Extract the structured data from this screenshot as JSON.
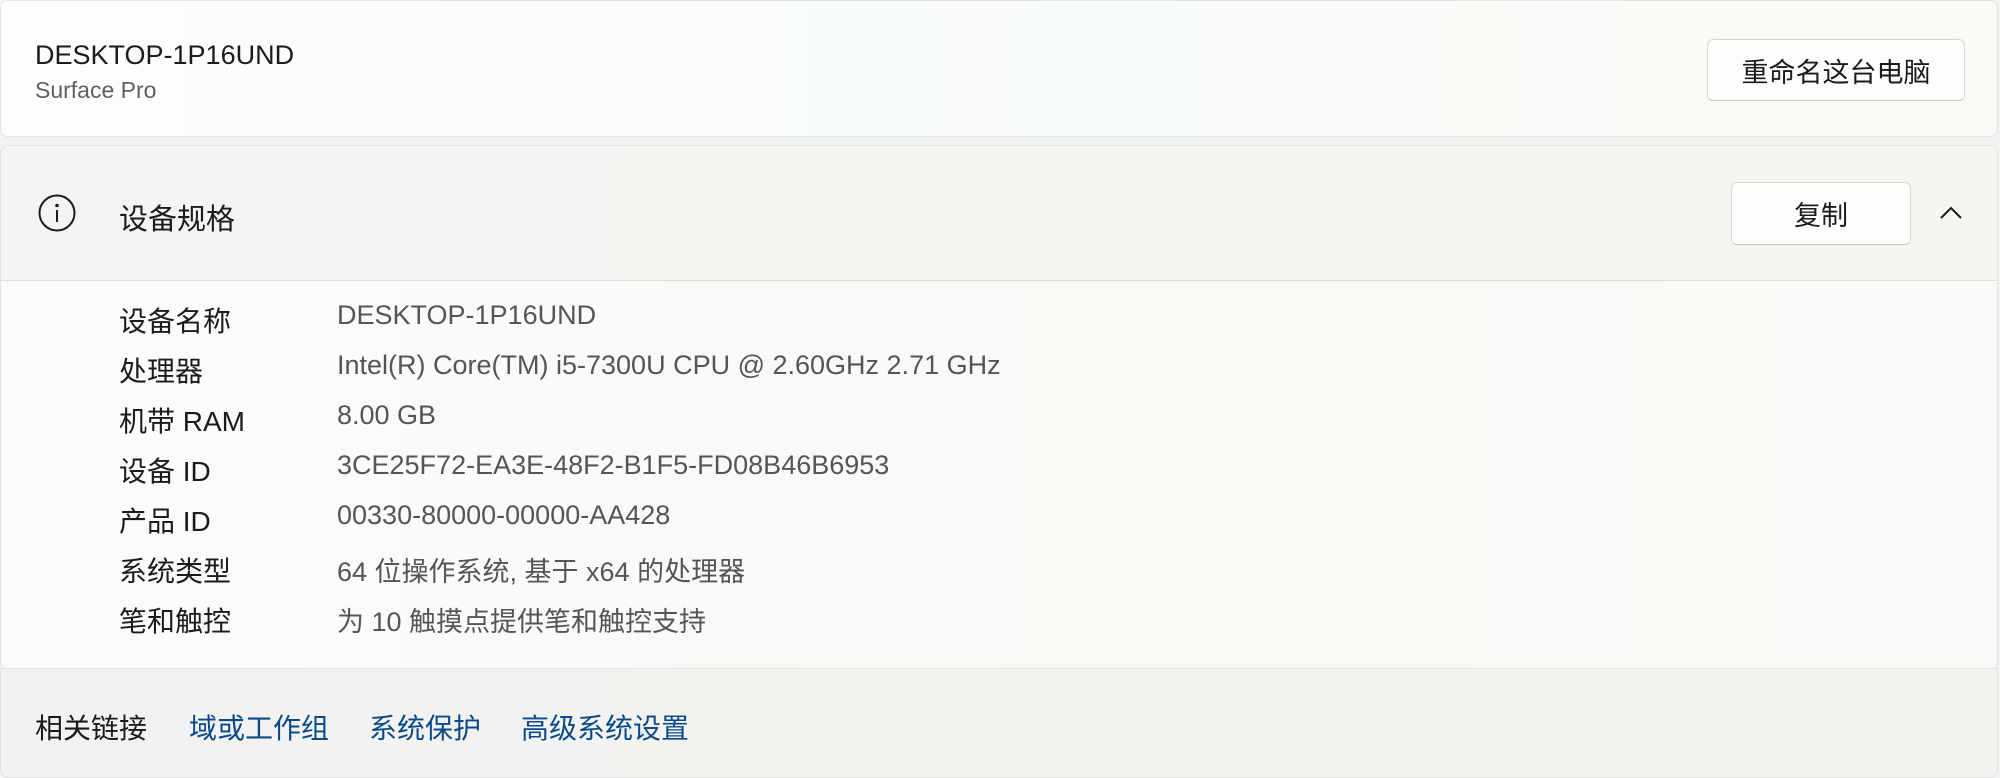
{
  "device": {
    "name": "DESKTOP-1P16UND",
    "model": "Surface Pro",
    "rename_label": "重命名这台电脑"
  },
  "specs": {
    "title": "设备规格",
    "icon": "info-icon",
    "copy_label": "复制",
    "collapse_icon": "chevron-up-icon",
    "rows": [
      {
        "label": "设备名称",
        "value": "DESKTOP-1P16UND"
      },
      {
        "label": "处理器",
        "value": "Intel(R) Core(TM) i5-7300U CPU @ 2.60GHz   2.71 GHz"
      },
      {
        "label": "机带 RAM",
        "value": "8.00 GB"
      },
      {
        "label": "设备 ID",
        "value": "3CE25F72-EA3E-48F2-B1F5-FD08B46B6953"
      },
      {
        "label": "产品 ID",
        "value": "00330-80000-00000-AA428"
      },
      {
        "label": "系统类型",
        "value": "64 位操作系统, 基于 x64 的处理器"
      },
      {
        "label": "笔和触控",
        "value": "为 10 触摸点提供笔和触控支持"
      }
    ]
  },
  "related": {
    "label": "相关链接",
    "links": [
      "域或工作组",
      "系统保护",
      "高级系统设置"
    ]
  },
  "colors": {
    "link": "#0a4a8a",
    "secondary_text": "#555555"
  }
}
